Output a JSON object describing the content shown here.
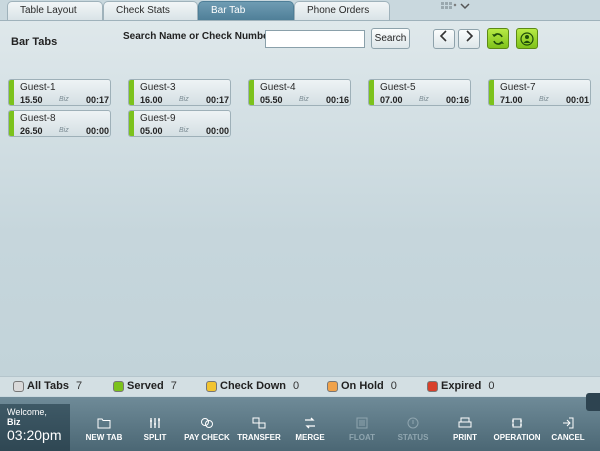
{
  "tabs": [
    {
      "label": "Table Layout",
      "active": false
    },
    {
      "label": "Check Stats",
      "active": false
    },
    {
      "label": "Bar Tab",
      "active": true
    },
    {
      "label": "Phone Orders",
      "active": false
    }
  ],
  "header": {
    "title": "Bar Tabs",
    "search_label": "Search Name or Check Number",
    "search_value": "",
    "search_button": "Search"
  },
  "tabs_list": [
    {
      "name": "Guest-1",
      "amount": "15.50",
      "server": "Biz",
      "time": "00:17"
    },
    {
      "name": "Guest-3",
      "amount": "16.00",
      "server": "Biz",
      "time": "00:17"
    },
    {
      "name": "Guest-4",
      "amount": "05.50",
      "server": "Biz",
      "time": "00:16"
    },
    {
      "name": "Guest-5",
      "amount": "07.00",
      "server": "Biz",
      "time": "00:16"
    },
    {
      "name": "Guest-7",
      "amount": "71.00",
      "server": "Biz",
      "time": "00:01"
    },
    {
      "name": "Guest-8",
      "amount": "26.50",
      "server": "Biz",
      "time": "00:00"
    },
    {
      "name": "Guest-9",
      "amount": "05.00",
      "server": "Biz",
      "time": "00:00"
    }
  ],
  "legend": [
    {
      "label": "All Tabs",
      "count": "7",
      "color": "#d9d9d9"
    },
    {
      "label": "Served",
      "count": "7",
      "color": "#7cc21c"
    },
    {
      "label": "Check Down",
      "count": "0",
      "color": "#f2c430"
    },
    {
      "label": "On Hold",
      "count": "0",
      "color": "#f0a24a"
    },
    {
      "label": "Expired",
      "count": "0",
      "color": "#d8402a"
    }
  ],
  "footer": {
    "welcome": "Welcome,",
    "user": "Biz",
    "time": "03:20pm"
  },
  "toolbar": [
    {
      "label": "NEW TAB",
      "icon": "folder-icon",
      "enabled": true
    },
    {
      "label": "SPLIT",
      "icon": "split-icon",
      "enabled": true
    },
    {
      "label": "PAY CHECK",
      "icon": "coins-icon",
      "enabled": true
    },
    {
      "label": "TRANSFER",
      "icon": "transfer-icon",
      "enabled": true
    },
    {
      "label": "MERGE",
      "icon": "merge-icon",
      "enabled": true
    },
    {
      "label": "FLOAT",
      "icon": "float-icon",
      "enabled": false
    },
    {
      "label": "STATUS",
      "icon": "status-icon",
      "enabled": false
    },
    {
      "label": "PRINT",
      "icon": "printer-icon",
      "enabled": true
    },
    {
      "label": "OPERATION",
      "icon": "operation-icon",
      "enabled": true
    },
    {
      "label": "CANCEL",
      "icon": "exit-icon",
      "enabled": true
    }
  ]
}
